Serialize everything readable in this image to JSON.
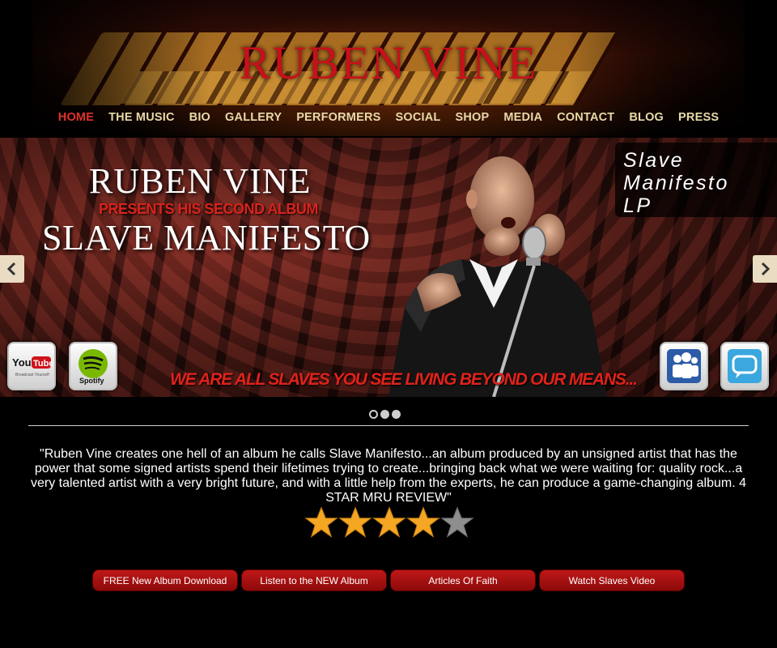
{
  "header": {
    "title": "RUBEN VINE"
  },
  "nav": {
    "items": [
      "HOME",
      "THE MUSIC",
      "BIO",
      "GALLERY",
      "PERFORMERS",
      "SOCIAL",
      "SHOP",
      "MEDIA",
      "CONTACT",
      "BLOG",
      "PRESS"
    ],
    "active_index": 0,
    "active_color": "#e0322a",
    "color": "#e8d9a8"
  },
  "slider": {
    "title": "RUBEN VINE",
    "subtitle": "PRESENTS HIS SECOND ALBUM",
    "album": "SLAVE MANIFESTO",
    "tagline": "WE ARE ALL SLAVES YOU SEE LIVING BEYOND OUR MEANS...",
    "caption_lines": [
      "Slave",
      "Manifesto",
      "LP"
    ],
    "prev_icon": "chevron-left-icon",
    "next_icon": "chevron-right-icon",
    "active_dot": 0,
    "dot_count": 3,
    "social_icons": [
      {
        "name": "youtube-icon",
        "label": "You Tube",
        "sub": "Broadcast Yourself"
      },
      {
        "name": "spotify-icon",
        "label": "Spotify"
      },
      {
        "name": "myspace-icon"
      },
      {
        "name": "twitter-icon"
      }
    ]
  },
  "review": {
    "quote": "\"Ruben Vine creates one hell of an album he calls Slave Manifesto...an album produced by an unsigned artist that has the power that some signed artists spend their lifetimes trying to create...bringing back what we were waiting for: quality rock...a very talented artist with a very bright future, and with a little help from the experts, he can produce a game-changing album. 4 STAR MRU REVIEW\"",
    "rating": 4,
    "rating_max": 5
  },
  "buttons": [
    "FREE New Album Download",
    "Listen to the NEW Album",
    "Articles Of Faith",
    "Watch Slaves Video"
  ],
  "colors": {
    "accent_red": "#c8101a",
    "button_red": "#b01414",
    "star_gold": "#f5a623"
  }
}
